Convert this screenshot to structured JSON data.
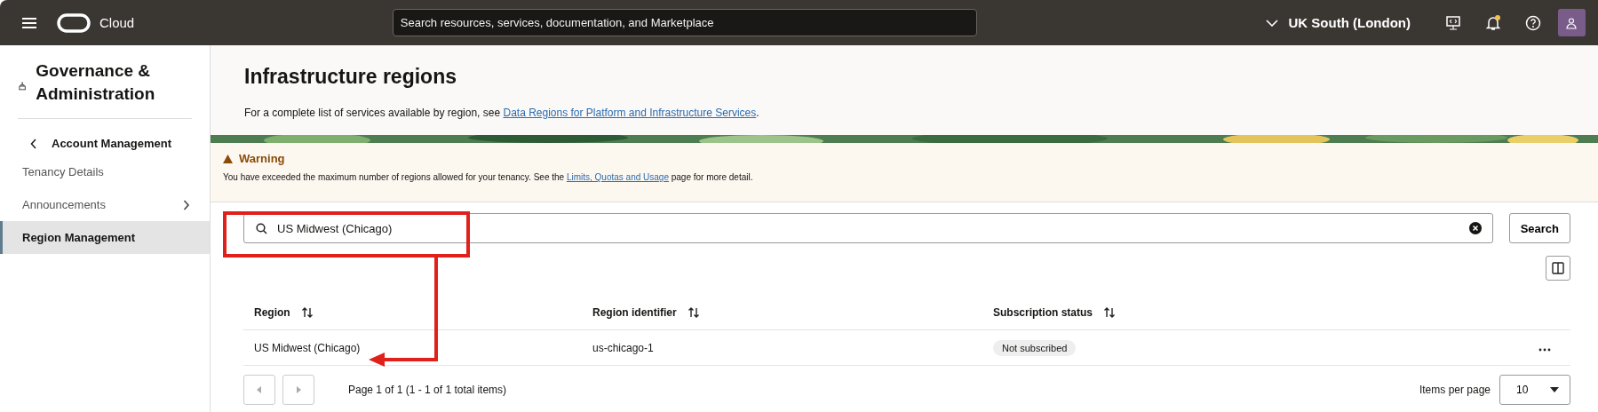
{
  "header": {
    "brand": "Cloud",
    "search_placeholder": "Search resources, services, documentation, and Marketplace",
    "region": "UK South (London)",
    "notification_dot": true
  },
  "sidebar": {
    "title": "Governance & Administration",
    "back_label": "Account Management",
    "items": [
      {
        "label": "Tenancy Details",
        "selected": false,
        "expandable": false
      },
      {
        "label": "Announcements",
        "selected": false,
        "expandable": true
      },
      {
        "label": "Region Management",
        "selected": true,
        "expandable": false
      }
    ]
  },
  "page": {
    "title": "Infrastructure regions",
    "description_prefix": "For a complete list of services available by region, see ",
    "description_link": "Data Regions for Platform and Infrastructure Services",
    "description_suffix": "."
  },
  "warning": {
    "title": "Warning",
    "text_prefix": "You have exceeded the maximum number of regions allowed for your tenancy. See the ",
    "link": "Limits, Quotas and Usage",
    "text_suffix": " page for more detail."
  },
  "search": {
    "value": "US Midwest (Chicago)",
    "button": "Search"
  },
  "table": {
    "columns": [
      {
        "label": "Region"
      },
      {
        "label": "Region identifier"
      },
      {
        "label": "Subscription status"
      }
    ],
    "rows": [
      {
        "region": "US Midwest (Chicago)",
        "identifier": "us-chicago-1",
        "status": "Not subscribed"
      }
    ]
  },
  "pagination": {
    "summary": "Page 1 of 1 (1 - 1 of 1 total items)",
    "items_per_page_label": "Items per page",
    "items_per_page": "10"
  }
}
